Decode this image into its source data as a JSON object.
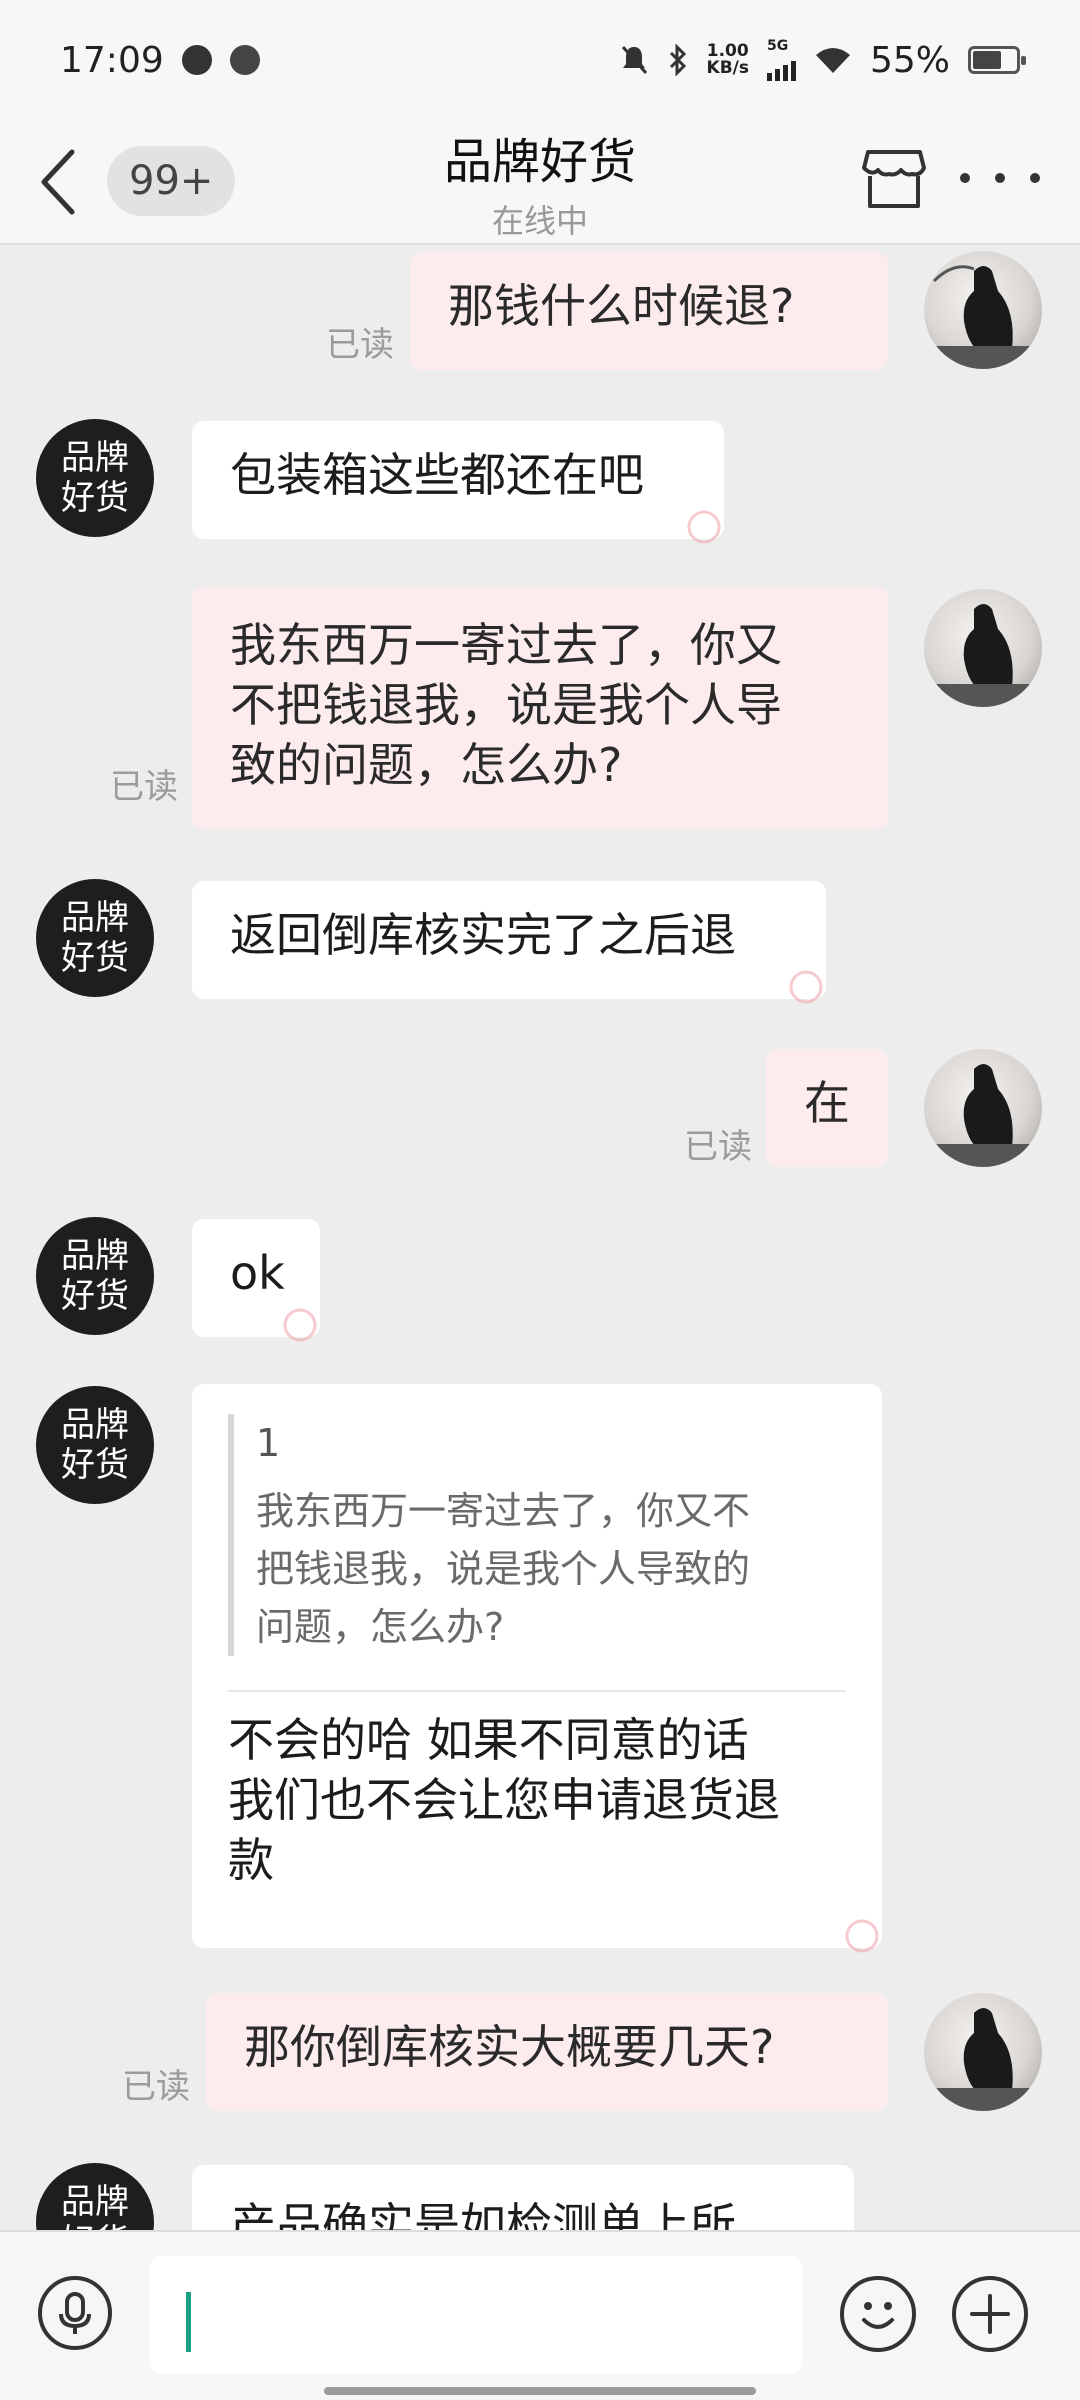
{
  "status_bar": {
    "time": "17:09",
    "net_speed_value": "1.00",
    "net_speed_unit": "KB/s",
    "network_type": "5G",
    "battery": "55%"
  },
  "header": {
    "unread_count": "99+",
    "title": "品牌好货",
    "status": "在线中"
  },
  "shop_avatar_text": [
    "品牌",
    "好货"
  ],
  "messages": [
    {
      "from": "user",
      "text": "那钱什么时候退?",
      "read": "已读"
    },
    {
      "from": "shop",
      "text": "包装箱这些都还在吧"
    },
    {
      "from": "user",
      "lines": [
        "我东西万一寄过去了，你又",
        "不把钱退我，说是我个人导",
        "致的问题，怎么办?"
      ],
      "read": "已读"
    },
    {
      "from": "shop",
      "text": "返回倒库核实完了之后退"
    },
    {
      "from": "user",
      "text": "在",
      "read": "已读"
    },
    {
      "from": "shop",
      "text": "ok"
    },
    {
      "from": "shop",
      "quote_index": "1",
      "quote_lines": [
        "我东西万一寄过去了，你又不",
        "把钱退我，说是我个人导致的",
        "问题，怎么办?"
      ],
      "reply_lines": [
        "不会的哈 如果不同意的话",
        "我们也不会让您申请退货退",
        "款"
      ]
    },
    {
      "from": "user",
      "text": "那你倒库核实大概要几天?",
      "read": "已读"
    },
    {
      "from": "shop",
      "text": "产品确实是如检测单上所"
    }
  ],
  "input": {
    "value": "",
    "placeholder": ""
  }
}
